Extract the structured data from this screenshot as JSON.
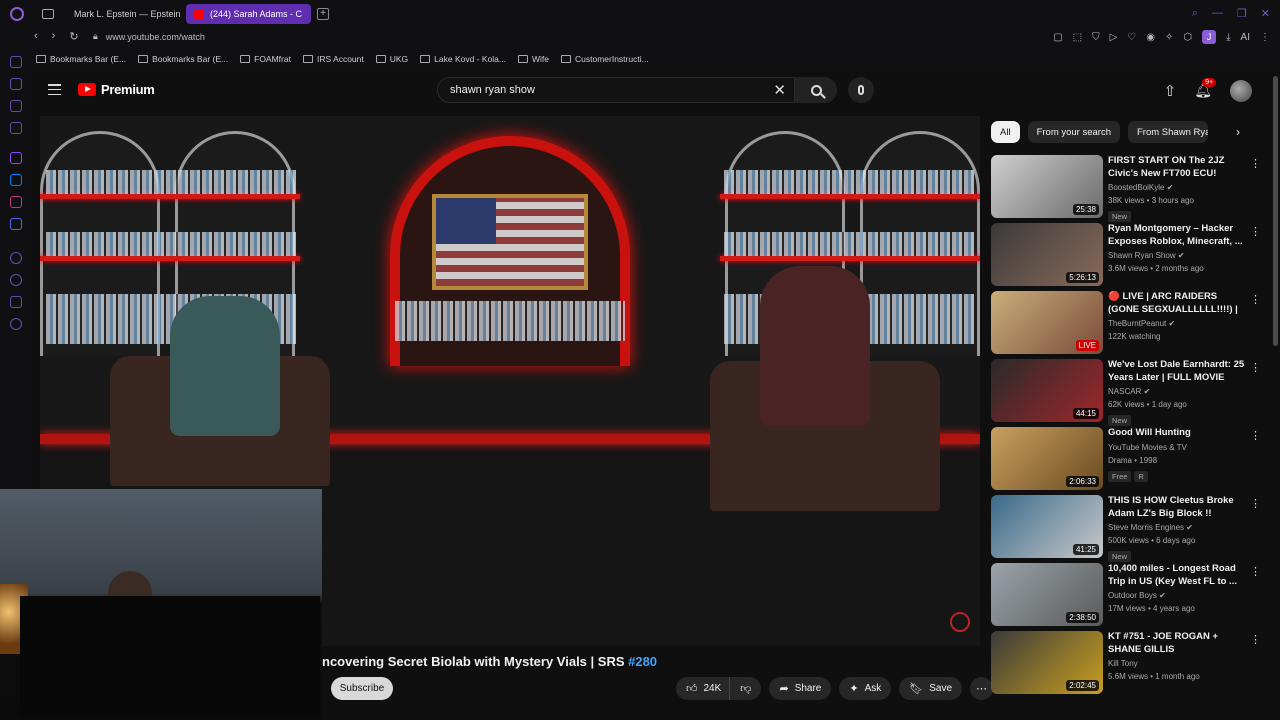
{
  "browser": {
    "tabs": [
      {
        "label": "Mark L. Epstein — Epstein",
        "active": false,
        "favicon_color": "#c0392b"
      },
      {
        "label": "(244) Sarah Adams - C",
        "active": true,
        "favicon_color": "#ff0000"
      }
    ],
    "url": "www.youtube.com/watch",
    "bookmarks": [
      "Bookmarks Bar (E...",
      "Bookmarks Bar (E...",
      "FOAMfrat",
      "IRS Account",
      "UKG",
      "Lake Kovd - Kola...",
      "Wife",
      "CustomerInstructi..."
    ],
    "profile_initial": "J",
    "ai_label": "AI",
    "accent_color": "#5f2db0"
  },
  "youtube": {
    "brand": "Premium",
    "search_query": "shawn ryan show",
    "notification_count": "9+",
    "video": {
      "title_prefix": "ncovering Secret Biolab with Mystery Vials | SRS ",
      "title_tag": "#280",
      "subscribe_label": "Subscribe",
      "likes": "24K",
      "share_label": "Share",
      "ask_label": "Ask",
      "save_label": "Save"
    },
    "filters": [
      "All",
      "From your search",
      "From Shawn Ryan Show"
    ],
    "recommendations": [
      {
        "title": "FIRST START ON The 2JZ Civic's New FT700 ECU!",
        "channel": "BoostedBoiKyle",
        "verified": true,
        "stats": "38K views • 3 hours ago",
        "duration": "25:38",
        "badges": [
          "New"
        ],
        "thumb_colors": [
          "#cfcfcf",
          "#6a6a6a"
        ]
      },
      {
        "title": "Ryan Montgomery – Hacker Exposes Roblox, Minecraft, ...",
        "channel": "Shawn Ryan Show",
        "verified": true,
        "stats": "3.6M views • 2 months ago",
        "duration": "5:26:13",
        "badges": [],
        "thumb_colors": [
          "#3a3a3a",
          "#8a6a5a"
        ]
      },
      {
        "title": "🔴 LIVE | ARC RAIDERS (GONE SEGXUALLLLLL!!!!) | ...",
        "channel": "TheBurntPeanut",
        "verified": true,
        "stats": "122K watching",
        "duration": "LIVE",
        "badges": [],
        "thumb_colors": [
          "#c9b07a",
          "#7a4a3a"
        ]
      },
      {
        "title": "We've Lost Dale Earnhardt: 25 Years Later | FULL MOVIE",
        "channel": "NASCAR",
        "verified": true,
        "stats": "62K views • 1 day ago",
        "duration": "44:15",
        "badges": [
          "New"
        ],
        "thumb_colors": [
          "#2a2a2a",
          "#a0262a"
        ]
      },
      {
        "title": "Good Will Hunting",
        "channel": "YouTube Movies & TV",
        "verified": false,
        "stats": "Drama • 1998",
        "duration": "2:06:33",
        "badges": [
          "Free",
          "R"
        ],
        "thumb_colors": [
          "#c9a060",
          "#6a4a20"
        ]
      },
      {
        "title": "THIS IS HOW Cleetus Broke Adam LZ's Big Block !!",
        "channel": "Steve Morris Engines",
        "verified": true,
        "stats": "500K views • 6 days ago",
        "duration": "41:25",
        "badges": [
          "New"
        ],
        "thumb_colors": [
          "#3a6a8a",
          "#c9c9c9"
        ]
      },
      {
        "title": "10,400 miles - Longest Road Trip in US (Key West FL to ...",
        "channel": "Outdoor Boys",
        "verified": true,
        "stats": "17M views • 4 years ago",
        "duration": "2:38:50",
        "badges": [],
        "thumb_colors": [
          "#9aa4aa",
          "#5a5a5a"
        ]
      },
      {
        "title": "KT #751 - JOE ROGAN + SHANE GILLIS",
        "channel": "Kill Tony",
        "verified": false,
        "stats": "5.6M views • 1 month ago",
        "duration": "2:02:45",
        "badges": [],
        "thumb_colors": [
          "#3a3a3a",
          "#c9a020"
        ]
      }
    ]
  }
}
